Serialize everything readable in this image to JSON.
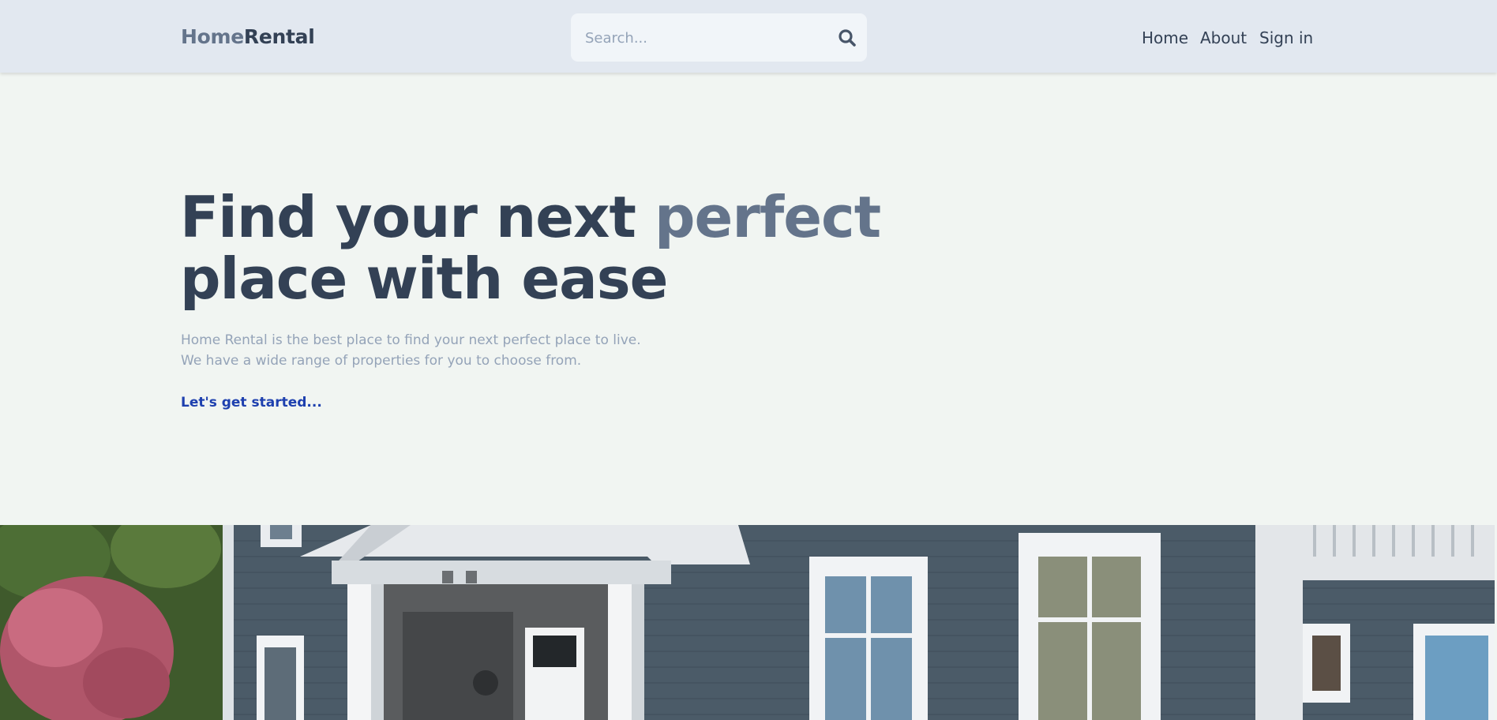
{
  "header": {
    "logo_part1": "Home",
    "logo_part2": "Rental",
    "search_placeholder": "Search...",
    "search_icon": "search-icon",
    "nav": {
      "home": "Home",
      "about": "About",
      "signin": "Sign in"
    }
  },
  "hero": {
    "title_part1": "Find your next ",
    "title_accent": "perfect",
    "title_part2": "place with ease",
    "desc_line1": "Home Rental is the best place to find your next perfect place to live.",
    "desc_line2": "We have a wide range of properties for you to choose from.",
    "cta": "Let's get started..."
  },
  "colors": {
    "header_bg": "#e2e8f0",
    "page_bg": "#f1f5f2",
    "text_dark": "#334155",
    "text_muted": "#64748b",
    "cta": "#1e40af"
  }
}
